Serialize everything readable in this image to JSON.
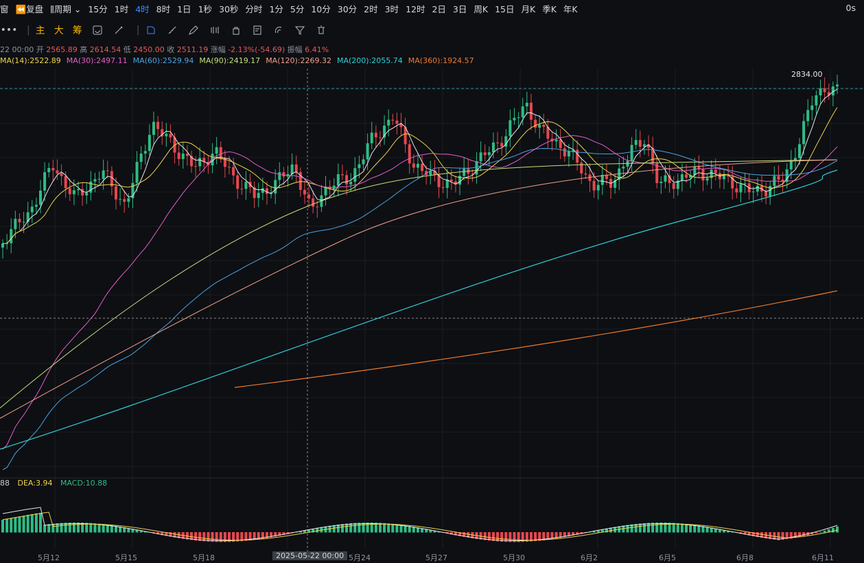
{
  "toolbar": {
    "window_label": "窗",
    "replay_label": "复盘",
    "period_label": "周期",
    "timeframes": [
      "15分",
      "1时",
      "4时",
      "8时",
      "1日",
      "1秒",
      "30秒",
      "分时",
      "1分",
      "5分",
      "10分",
      "30分",
      "2时",
      "3时",
      "12时",
      "2日",
      "3日",
      "周K",
      "15日",
      "月K",
      "季K",
      "年K"
    ],
    "selected": "4时",
    "timer": "0s"
  },
  "tools": {
    "main": "主",
    "big": "大",
    "chips": "筹",
    "icons": [
      "refresh-icon",
      "pen-icon",
      "ruler-icon",
      "shape-icon",
      "pencil-icon",
      "indicator-icon",
      "lock-icon",
      "note-icon",
      "magnet-icon",
      "filter-icon",
      "trash-icon"
    ]
  },
  "ohlc": {
    "time": "22 00:00",
    "open_label": "开",
    "open": "2565.89",
    "high_label": "高",
    "high": "2614.54",
    "low_label": "低",
    "low": "2450.00",
    "close_label": "收",
    "close": "2511.19",
    "change_label": "涨幅",
    "change": "-2.13%(-54.69)",
    "amp_label": "振幅",
    "amp": "6.41%"
  },
  "ma_lines": [
    {
      "text": "MA(14):2522.89",
      "color": "#f0d44a"
    },
    {
      "text": "MA(30):2497.11",
      "color": "#e55ec8"
    },
    {
      "text": "MA(60):2529.94",
      "color": "#4ea3e0"
    },
    {
      "text": "MA(90):2419.17",
      "color": "#c5e07a"
    },
    {
      "text": "MA(120):2269.32",
      "color": "#f0a08a"
    },
    {
      "text": "MA(200):2055.74",
      "color": "#2fd0d6"
    },
    {
      "text": "MA(360):1924.57",
      "color": "#f07a2a"
    }
  ],
  "macd": {
    "diff": "88",
    "dea": "DEA:3.94",
    "macd": "MACD:10.88"
  },
  "x_labels": [
    "5月12",
    "5月15",
    "5月18",
    "5月24",
    "5月27",
    "5月30",
    "6月2",
    "6月5",
    "6月8",
    "6月11"
  ],
  "crosshair_date": "2025-05-22 00:00",
  "high_marker": "2834.00",
  "colors": {
    "up": "#2ebd85",
    "down": "#e5484d",
    "accent": "#3d8bff"
  }
}
